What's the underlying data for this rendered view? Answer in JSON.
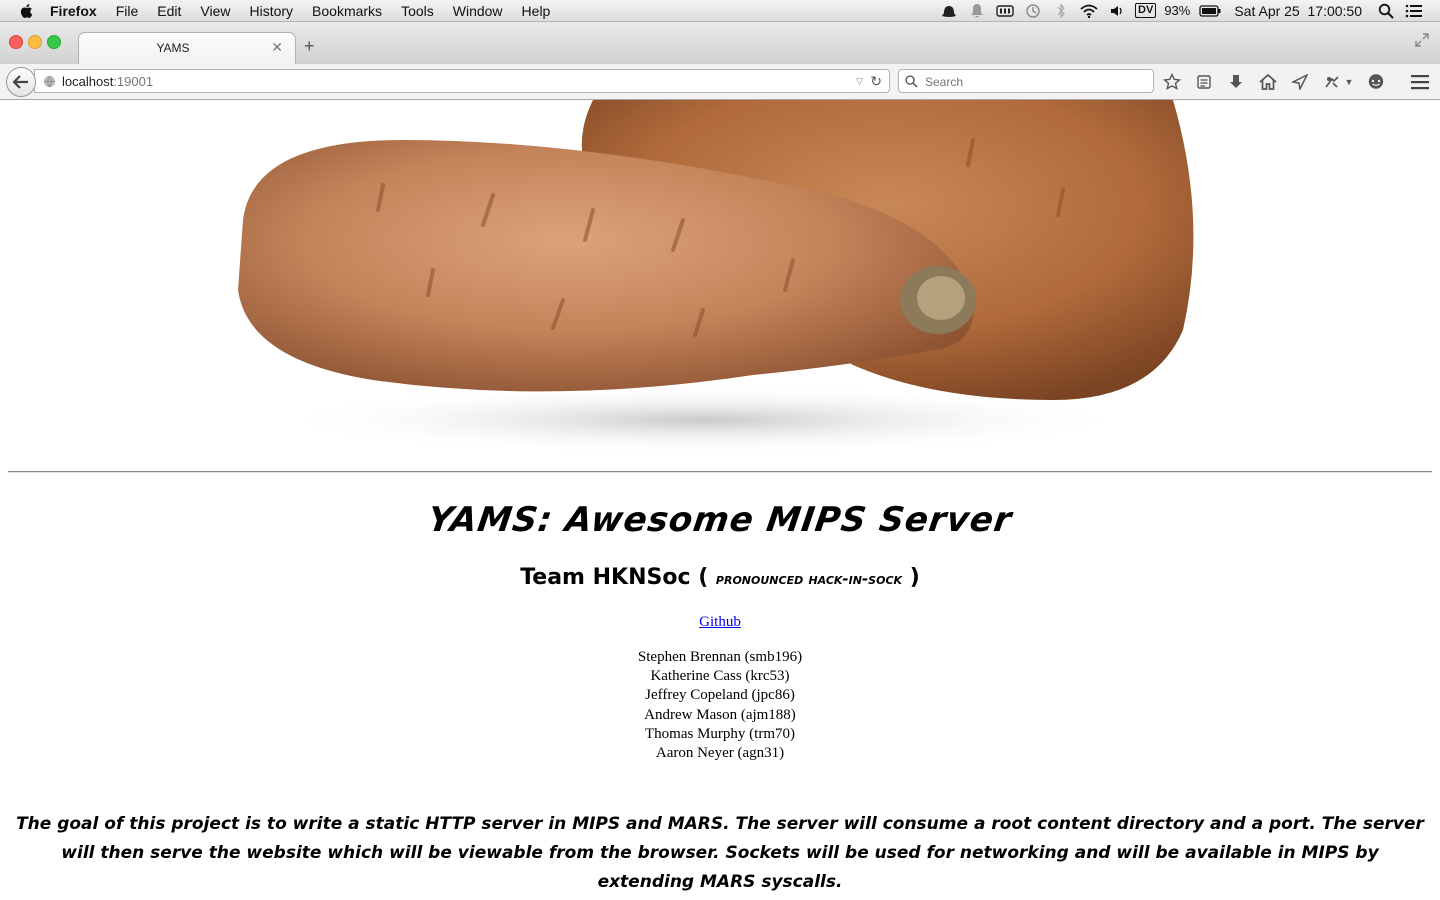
{
  "menubar": {
    "items": [
      {
        "label": "Firefox"
      },
      {
        "label": "File"
      },
      {
        "label": "Edit"
      },
      {
        "label": "View"
      },
      {
        "label": "History"
      },
      {
        "label": "Bookmarks"
      },
      {
        "label": "Tools"
      },
      {
        "label": "Window"
      },
      {
        "label": "Help"
      }
    ],
    "status": {
      "display_label": "DV",
      "battery_percent": "93%",
      "datetime": "Sat Apr 25  17:00:50"
    }
  },
  "browser": {
    "tab_title": "YAMS",
    "url_host": "localhost",
    "url_port": ":19001",
    "search_placeholder": "Search"
  },
  "page": {
    "title": "YAMS: Awesome MIPS Server",
    "team_name": "Team HKNSoc",
    "team_open_paren": "(",
    "team_pronunciation": "pronounced hack-in-sock",
    "team_close_paren": ")",
    "github_label": "Github",
    "members": [
      "Stephen Brennan (smb196)",
      "Katherine Cass (krc53)",
      "Jeffrey Copeland (jpc86)",
      "Andrew Mason (ajm188)",
      "Thomas Murphy (trm70)",
      "Aaron Neyer (agn31)"
    ],
    "description": "The goal of this project is to write a static HTTP server in MIPS and MARS. The server will consume a root content directory and a port. The server will then serve the website which will be viewable from the browser. Sockets will be used for networking and will be available in MIPS by extending MARS syscalls."
  }
}
